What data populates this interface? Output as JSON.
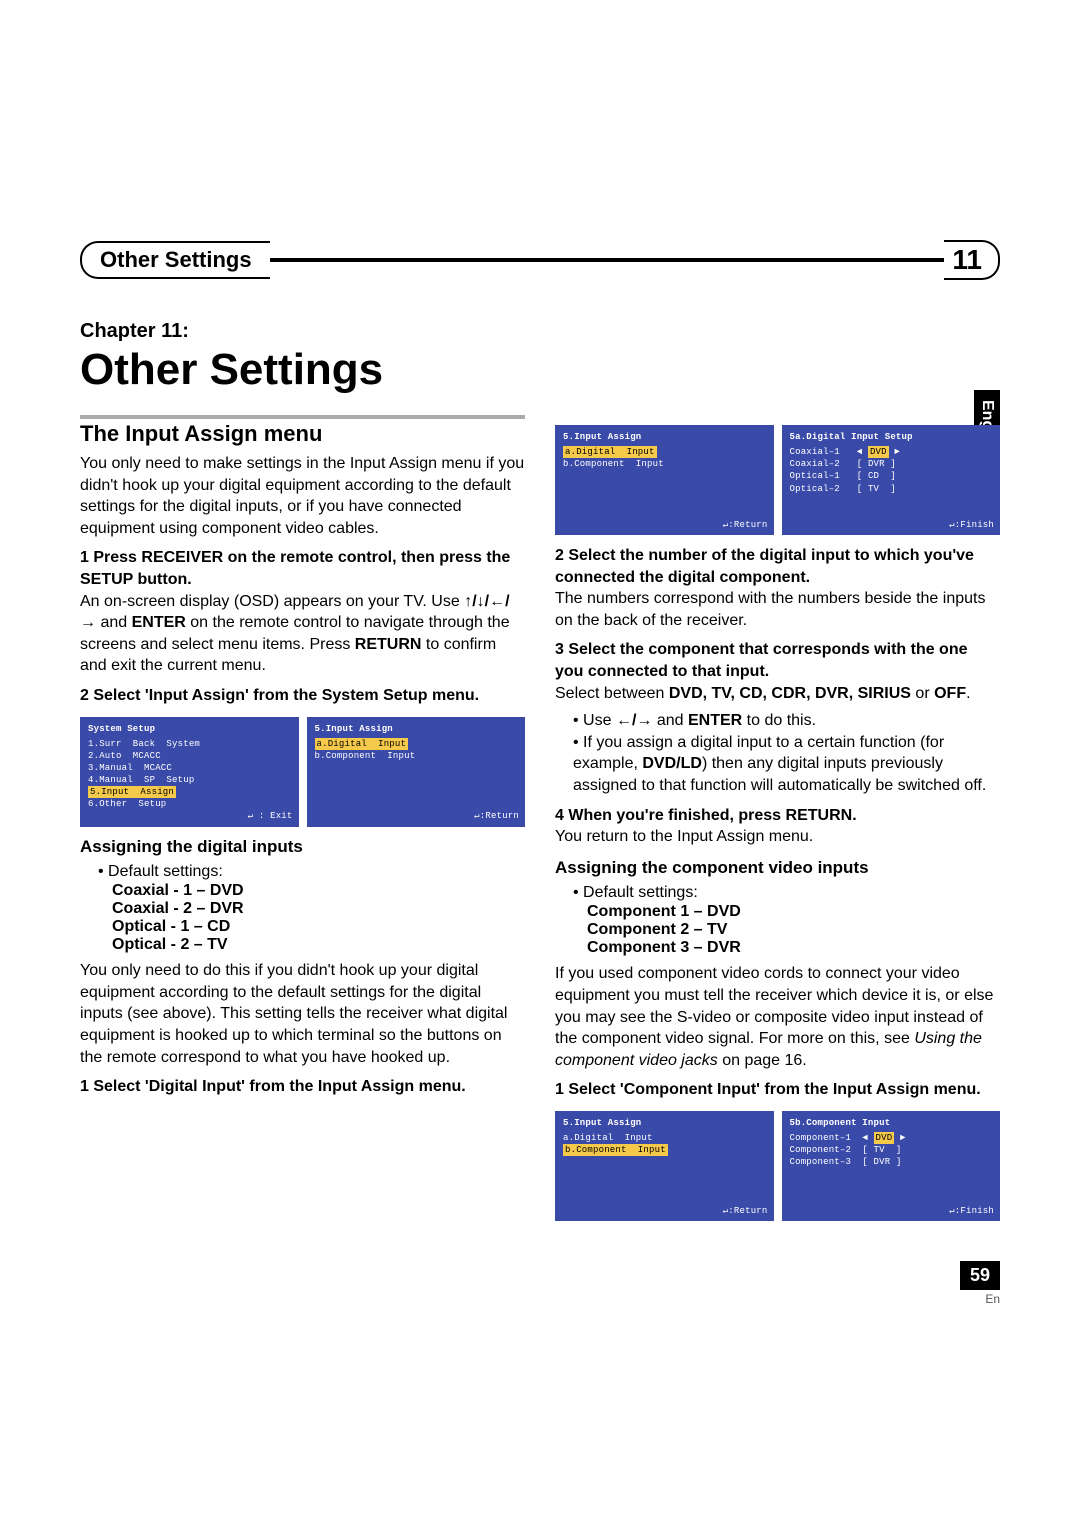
{
  "header": {
    "title": "Other Settings",
    "chapterNumber": "11",
    "chapterLabel": "Chapter 11:",
    "chapterTitle": "Other Settings",
    "langTab": "English"
  },
  "left": {
    "sectionHead": "The Input Assign menu",
    "intro": "You only need to make settings in the Input Assign menu if you didn't hook up your digital equipment according to the default settings for the digital inputs, or if you have connected equipment using component video cables.",
    "step1": "1   Press RECEIVER on the remote control, then press the SETUP button.",
    "step1body_a": "An on-screen display (OSD) appears on your TV. Use ",
    "step1body_arrows": "↑/↓/←/→",
    "step1body_b": " and ",
    "step1body_enter": "ENTER",
    "step1body_c": " on the remote control to navigate through the screens and select menu items. Press ",
    "step1body_return": "RETURN",
    "step1body_d": " to confirm and exit the current menu.",
    "step2": "2   Select 'Input Assign' from the System Setup menu.",
    "osdA_title": "System  Setup",
    "osdA_1": "1.Surr  Back  System",
    "osdA_2": "2.Auto  MCACC",
    "osdA_3": "3.Manual  MCACC",
    "osdA_4": "4.Manual  SP  Setup",
    "osdA_5": "5.Input  Assign",
    "osdA_6": "6.Other  Setup",
    "osdA_foot": "↵ : Exit",
    "osdB_title": "5.Input  Assign",
    "osdB_a": "a.Digital  Input",
    "osdB_b": "b.Component  Input",
    "osdB_foot": "↵:Return",
    "sub1": "Assigning the digital inputs",
    "defaultLabel": "Default settings:",
    "d1": "Coaxial - 1 – DVD",
    "d2": "Coaxial - 2 – DVR",
    "d3": "Optical - 1 – CD",
    "d4": "Optical - 2 – TV",
    "para2": "You only need to do this if you didn't hook up your digital equipment according to the default settings for the digital inputs (see above). This setting tells the receiver what digital equipment is hooked up to which terminal so the buttons on the remote correspond to what you have hooked up.",
    "step1b": "1   Select 'Digital Input' from the Input Assign menu."
  },
  "right": {
    "osdC_title": "5.Input  Assign",
    "osdC_a": "a.Digital  Input",
    "osdC_b": "b.Component  Input",
    "osdC_foot": "↵:Return",
    "osdD_title": "5a.Digital  Input  Setup",
    "osdD_1a": "Coaxial–1",
    "osdD_1b": "DVD",
    "osdD_2a": "Coaxial–2",
    "osdD_2b": "DVR",
    "osdD_3a": "Optical–1",
    "osdD_3b": "CD",
    "osdD_4a": "Optical–2",
    "osdD_4b": "TV",
    "osdD_foot": "↵:Finish",
    "step2r": "2   Select the number of the digital input to which you've connected the digital component.",
    "step2body": "The numbers correspond with the numbers beside the inputs on the back of the receiver.",
    "step3r": "3   Select the component that corresponds with the one you connected to that input.",
    "step3body_a": "Select between ",
    "step3body_list": "DVD, TV, CD, CDR, DVR, SIRIUS",
    "step3body_or": " or ",
    "step3body_off": "OFF",
    "step3body_dot": ".",
    "bul_use_a": "Use ",
    "bul_use_arrows": "←/→",
    "bul_use_b": " and ",
    "bul_use_enter": "ENTER",
    "bul_use_c": " to do this.",
    "bul_assign": "If you assign a digital input to a certain function (for example, ",
    "bul_assign_bold": "DVD/LD",
    "bul_assign_b": ") then any digital inputs previously assigned to that function will automatically be switched off.",
    "step4r": "4   When you're finished, press RETURN.",
    "step4body": "You return to the Input Assign menu.",
    "sub2": "Assigning the component video inputs",
    "defaultLabel": "Default settings:",
    "c1": "Component 1 – DVD",
    "c2": "Component 2 – TV",
    "c3": "Component 3 – DVR",
    "para_comp_a": "If you used component video cords to connect your video equipment you must tell the receiver which device it is, or else you may see the S-video or composite video input instead of the component video signal. For more on this, see ",
    "para_comp_i": "Using the component video jacks",
    "para_comp_b": " on page 16.",
    "step1c": "1   Select 'Component Input' from the Input Assign menu.",
    "osdE_title": "5.Input  Assign",
    "osdE_a": "a.Digital  Input",
    "osdE_b": "b.Component  Input",
    "osdE_foot": "↵:Return",
    "osdF_title": "5b.Component  Input",
    "osdF_1a": "Component–1",
    "osdF_1b": "DVD",
    "osdF_2a": "Component–2",
    "osdF_2b": "TV",
    "osdF_3a": "Component–3",
    "osdF_3b": "DVR",
    "osdF_foot": "↵:Finish"
  },
  "footer": {
    "pageNum": "59",
    "en": "En"
  }
}
